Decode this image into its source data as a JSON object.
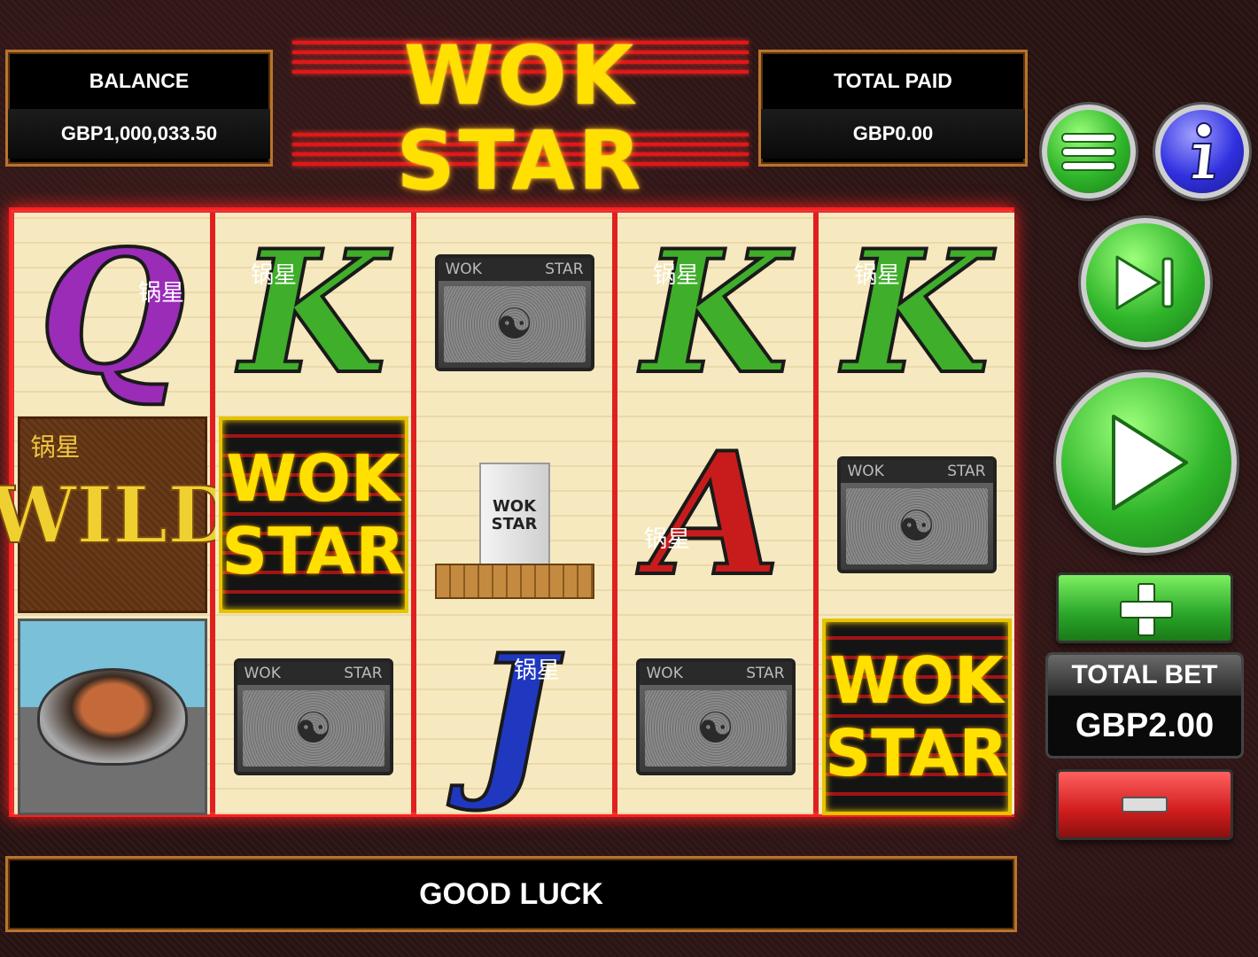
{
  "game": {
    "logo_line1": "WOK",
    "logo_line2": "STAR"
  },
  "balance": {
    "label": "BALANCE",
    "value": "GBP1,000,033.50"
  },
  "total_paid": {
    "label": "TOTAL PAID",
    "value": "GBP0.00"
  },
  "reels": [
    [
      "Q",
      "WILD",
      "WOK"
    ],
    [
      "K",
      "WOK STAR",
      "AMP"
    ],
    [
      "AMP",
      "BOX",
      "J"
    ],
    [
      "K",
      "A",
      "AMP"
    ],
    [
      "K",
      "AMP",
      "WOK STAR"
    ]
  ],
  "symbols": {
    "q": "Q",
    "k": "K",
    "a": "A",
    "j": "J",
    "wild": "WILD",
    "wokstar_line1": "WOK",
    "wokstar_line2": "STAR",
    "amp_left": "WOK",
    "amp_right": "STAR",
    "box_label_1": "WOK",
    "box_label_2": "STAR",
    "chinese_mark": "锅星"
  },
  "message": "GOOD LUCK",
  "total_bet": {
    "label": "TOTAL BET",
    "value": "GBP2.00"
  },
  "controls": {
    "menu_icon": "hamburger-icon",
    "info_icon": "info-icon",
    "skip_icon": "skip-forward-icon",
    "spin_icon": "play-icon",
    "plus_icon": "plus-icon",
    "minus_icon": "minus-icon"
  },
  "colors": {
    "panel_border": "#b8742c",
    "reel_frame": "#ff2020",
    "logo_yellow": "#ffe000",
    "button_green": "#2fb52a",
    "button_blue": "#3030e0",
    "button_red": "#d01c1c"
  }
}
